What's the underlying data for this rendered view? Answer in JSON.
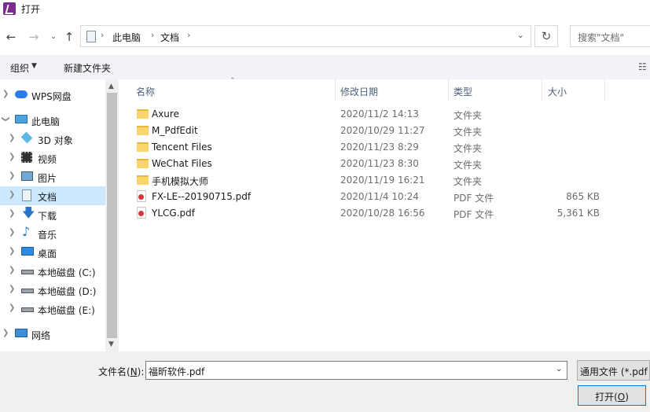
{
  "window": {
    "title": "打开"
  },
  "address": {
    "crumbs": [
      "此电脑",
      "文档"
    ],
    "search_placeholder": "搜索\"文档\""
  },
  "toolbar": {
    "organize": "组织",
    "new_folder": "新建文件夹"
  },
  "nav": {
    "items": [
      {
        "label": "WPS网盘",
        "icon": "cloud-icon"
      },
      {
        "label": "此电脑",
        "icon": "computer-icon"
      },
      {
        "label": "3D 对象",
        "icon": "cube-icon"
      },
      {
        "label": "视频",
        "icon": "video-icon"
      },
      {
        "label": "图片",
        "icon": "picture-icon"
      },
      {
        "label": "文档",
        "icon": "document-icon",
        "selected": true
      },
      {
        "label": "下载",
        "icon": "download-icon"
      },
      {
        "label": "音乐",
        "icon": "music-icon"
      },
      {
        "label": "桌面",
        "icon": "desktop-icon"
      },
      {
        "label": "本地磁盘 (C:)",
        "icon": "drive-c-icon"
      },
      {
        "label": "本地磁盘 (D:)",
        "icon": "drive-icon"
      },
      {
        "label": "本地磁盘 (E:)",
        "icon": "drive-icon"
      },
      {
        "label": "网络",
        "icon": "network-icon"
      }
    ]
  },
  "columns": {
    "name": "名称",
    "date": "修改日期",
    "type": "类型",
    "size": "大小"
  },
  "files": [
    {
      "name": "Axure",
      "date": "2020/11/2 14:13",
      "type": "文件夹",
      "size": "",
      "kind": "folder"
    },
    {
      "name": "M_PdfEdit",
      "date": "2020/10/29 11:27",
      "type": "文件夹",
      "size": "",
      "kind": "folder"
    },
    {
      "name": "Tencent Files",
      "date": "2020/11/23 8:29",
      "type": "文件夹",
      "size": "",
      "kind": "folder"
    },
    {
      "name": "WeChat Files",
      "date": "2020/11/23 8:30",
      "type": "文件夹",
      "size": "",
      "kind": "folder"
    },
    {
      "name": "手机模拟大师",
      "date": "2020/11/19 16:21",
      "type": "文件夹",
      "size": "",
      "kind": "folder"
    },
    {
      "name": "FX-LE--20190715.pdf",
      "date": "2020/11/4 10:24",
      "type": "PDF 文件",
      "size": "865 KB",
      "kind": "pdf"
    },
    {
      "name": "YLCG.pdf",
      "date": "2020/10/28 16:56",
      "type": "PDF 文件",
      "size": "5,361 KB",
      "kind": "pdf"
    }
  ],
  "bottom": {
    "filename_label": "文件名(",
    "filename_key": "N",
    "filename_label_end": "):",
    "filename_value": "福昕软件.pdf",
    "filter": "通用文件 (*.pdf",
    "open_label": "打开(",
    "open_key": "O",
    "open_label_end": ")"
  }
}
